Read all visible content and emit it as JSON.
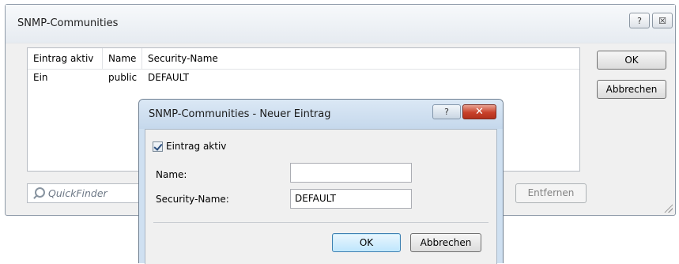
{
  "outer_window": {
    "title": "SNMP-Communities",
    "help_icon": "?",
    "close_icon": "☒",
    "table": {
      "columns": [
        "Eintrag aktiv",
        "Name",
        "Security-Name"
      ],
      "rows": [
        [
          "Ein",
          "public",
          "DEFAULT"
        ]
      ]
    },
    "ok_label": "OK",
    "cancel_label": "Abbrechen",
    "quickfinder_placeholder": "QuickFinder",
    "remove_label": "Entfernen"
  },
  "dialog": {
    "title": "SNMP-Communities - Neuer Eintrag",
    "help_icon": "?",
    "close_icon": "✕",
    "active_checkbox_label": "Eintrag aktiv",
    "active_checked": true,
    "name_label": "Name:",
    "name_value": "",
    "security_name_label": "Security-Name:",
    "security_name_value": "DEFAULT",
    "ok_label": "OK",
    "cancel_label": "Abbrechen"
  }
}
